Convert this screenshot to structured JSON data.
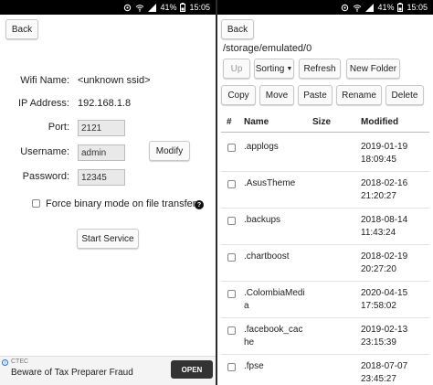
{
  "status_bar": {
    "battery": "41%",
    "time": "15:05"
  },
  "left": {
    "back_label": "Back",
    "wifi_name_label": "Wifi Name:",
    "wifi_name_value": "<unknown ssid>",
    "ip_label": "IP Address:",
    "ip_value": "192.168.1.8",
    "port_label": "Port:",
    "port_value": "2121",
    "username_label": "Username:",
    "username_value": "admin",
    "password_label": "Password:",
    "password_value": "12345",
    "modify_label": "Modify",
    "binary_mode_label": "Force binary mode on file transfer",
    "help_glyph": "?",
    "start_label": "Start Service"
  },
  "ad": {
    "sponsor": "CTEC",
    "headline": "Beware of Tax Preparer Fraud",
    "open_label": "OPEN",
    "info_glyph": "i"
  },
  "right": {
    "back_label": "Back",
    "path": "/storage/emulated/0",
    "toolbar": {
      "up": "Up",
      "sorting": "Sorting",
      "refresh": "Refresh",
      "new_folder": "New Folder",
      "copy": "Copy",
      "move": "Move",
      "paste": "Paste",
      "rename": "Rename",
      "delete": "Delete"
    },
    "columns": {
      "index": "#",
      "name": "Name",
      "size": "Size",
      "modified": "Modified"
    },
    "files": [
      {
        "name": ".applogs",
        "date": "2019-01-19",
        "time": "18:09:45"
      },
      {
        "name": ".AsusTheme",
        "date": "2018-02-16",
        "time": "21:20:27"
      },
      {
        "name": ".backups",
        "date": "2018-08-14",
        "time": "11:43:24"
      },
      {
        "name": ".chartboost",
        "date": "2018-02-19",
        "time": "20:27:20"
      },
      {
        "name": ".ColombiaMedia",
        "date": "2020-04-15",
        "time": "17:58:02"
      },
      {
        "name": ".facebook_cache",
        "date": "2019-02-13",
        "time": "23:15:39"
      },
      {
        "name": ".fpse",
        "date": "2018-07-07",
        "time": "23:45:27"
      }
    ]
  }
}
